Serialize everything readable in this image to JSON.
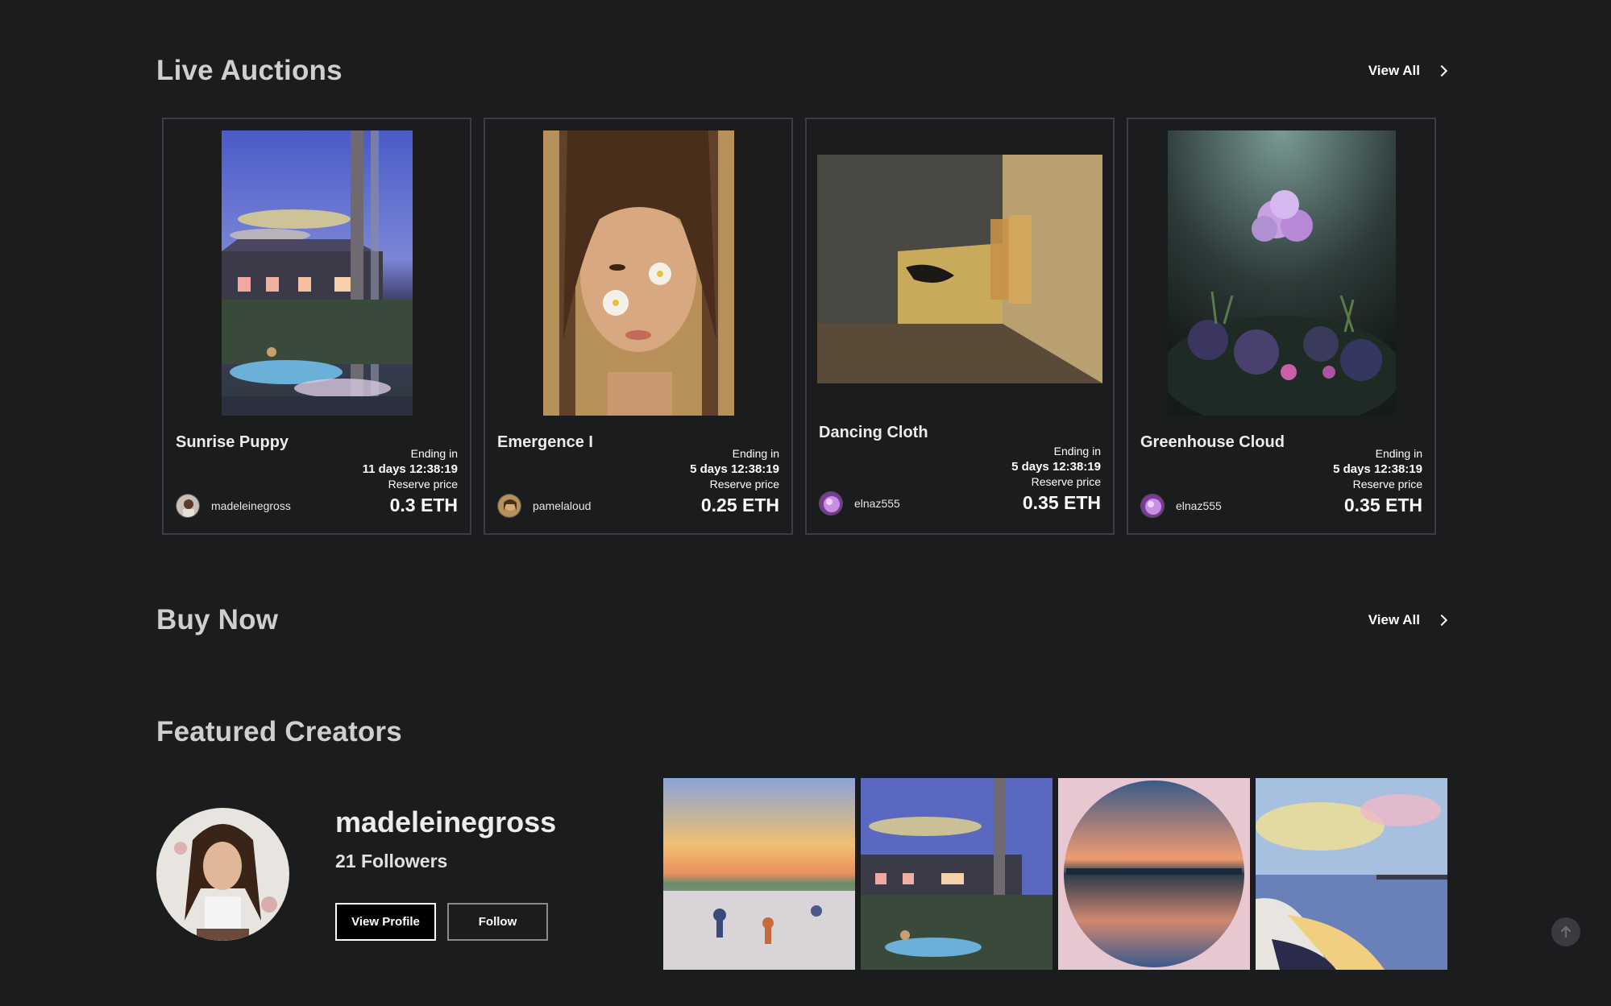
{
  "live_auctions": {
    "title": "Live Auctions",
    "view_all": "View All",
    "cards": [
      {
        "title": "Sunrise Puppy",
        "ending_label": "Ending in",
        "time": "11 days 12:38:19",
        "reserve_label": "Reserve price",
        "user": "madeleinegross",
        "price": "0.3 ETH"
      },
      {
        "title": "Emergence I",
        "ending_label": "Ending in",
        "time": "5 days 12:38:19",
        "reserve_label": "Reserve price",
        "user": "pamelaloud",
        "price": "0.25 ETH"
      },
      {
        "title": "Dancing Cloth",
        "ending_label": "Ending in",
        "time": "5 days 12:38:19",
        "reserve_label": "Reserve price",
        "user": "elnaz555",
        "price": "0.35 ETH"
      },
      {
        "title": "Greenhouse Cloud",
        "ending_label": "Ending in",
        "time": "5 days 12:38:19",
        "reserve_label": "Reserve price",
        "user": "elnaz555",
        "price": "0.35 ETH"
      }
    ]
  },
  "buy_now": {
    "title": "Buy Now",
    "view_all": "View All"
  },
  "featured_creators": {
    "title": "Featured Creators",
    "name": "madeleinegross",
    "followers": "21 Followers",
    "view_profile": "View Profile",
    "follow": "Follow"
  },
  "icons": {
    "view_all": "chevron-right-icon",
    "scroll_top": "arrow-up-icon"
  },
  "colors": {
    "background": "#1b1c1e",
    "card_border": "#3d3e41"
  }
}
